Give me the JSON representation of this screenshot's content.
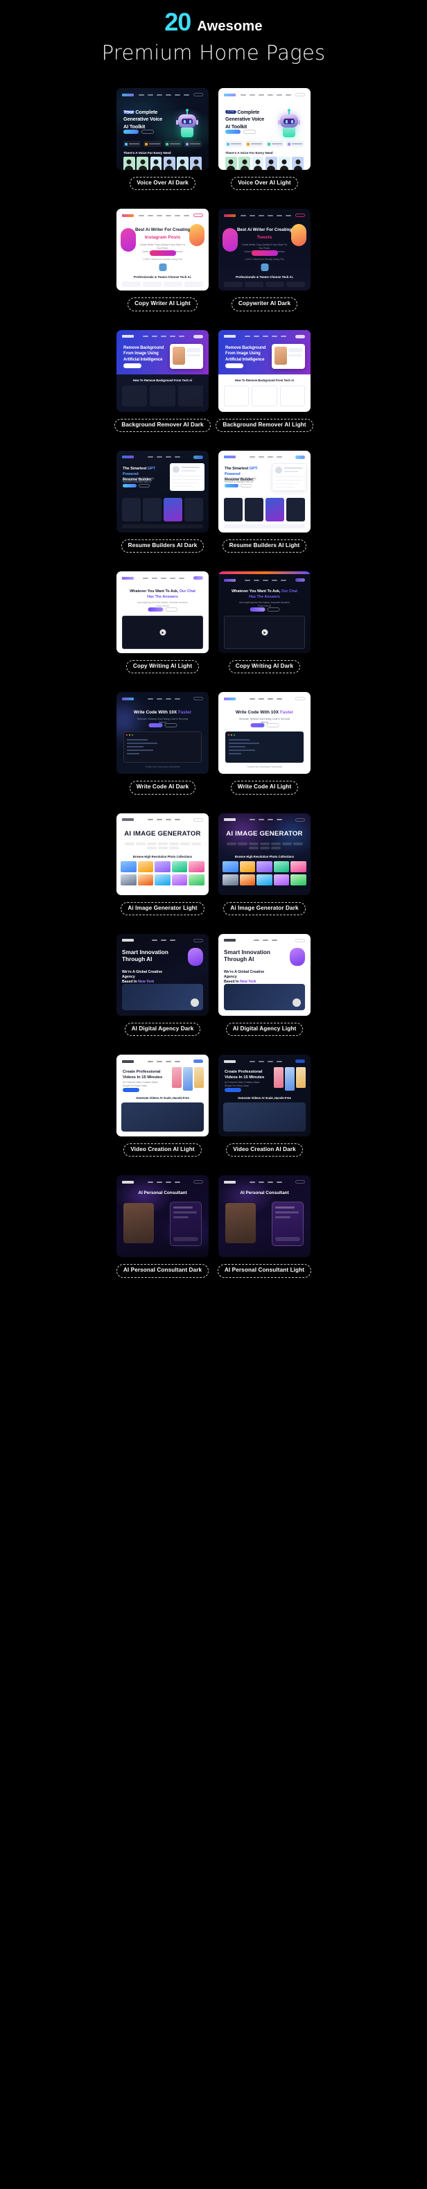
{
  "header": {
    "count": "20",
    "count_color": "#3FDCF7",
    "count_suffix": "Awesome",
    "subtitle": "Premium Home Pages"
  },
  "background_color": "#000000",
  "cards": [
    {
      "id": "voice-over-ai-dark",
      "caption": "Voice Over AI Dark",
      "theme": "dark",
      "preview": {
        "badge": "AI Voice",
        "badge_sub": "Generative Ai Text To Speech",
        "headline": "Your Complete\nGenerative Voice\nAI Toolkit",
        "cta_primary": "Get Started",
        "cta_secondary": "Request A Demo",
        "features": [
          "Text To Speech",
          "Speech To Speech",
          "Voice Editing",
          "Language Dubbing"
        ],
        "section_title": "There's A Voice For Every Need"
      }
    },
    {
      "id": "voice-over-ai-light",
      "caption": "Voice Over AI Light",
      "theme": "light",
      "preview": {
        "badge": "AI Voice",
        "badge_sub": "Generative Ai Text To Speech",
        "headline": "Your Complete\nGenerative Voice\nAI Toolkit",
        "cta_primary": "Get Started",
        "cta_secondary": "Request A Demo",
        "features": [
          "Text To Speech",
          "Speech To Speech",
          "Voice Editing",
          "Language Dubbing"
        ],
        "section_title": "There's A Voice For Every Need"
      }
    },
    {
      "id": "copy-writer-ai-light",
      "caption": "Copy Writer AI Light",
      "theme": "light",
      "preview": {
        "headline": "Best Ai Writer For Creating",
        "headline_accent": "Instagram Posts",
        "accent_color": "#E8317B",
        "cta_primary": "Start Writing Now",
        "cta_note": "1,500+ Clients Are Already Using This",
        "section_title": "Professionals & Teams Choose Tech Ai."
      }
    },
    {
      "id": "copywriter-ai-dark",
      "caption": "Copywriter AI Dark",
      "theme": "dark",
      "preview": {
        "headline": "Best Ai Writer For Creating",
        "headline_accent": "Tweets",
        "accent_color": "#E8317B",
        "cta_primary": "Start Writing Now",
        "cta_note": "1,500+ Clients Are Already Using This",
        "section_title": "Professionals & Teams Choose Tech Ai."
      }
    },
    {
      "id": "background-remover-ai-dark",
      "caption": "Background Remover AI Dark",
      "theme": "dark",
      "preview": {
        "headline": "Remove Background\nFrom Image Using\nArtificial Intelligence",
        "cta_primary": "Upload Image",
        "section_title": "How To Remove Background From Tech Ai"
      }
    },
    {
      "id": "background-remover-ai-light",
      "caption": "Background Remover AI Light",
      "theme": "light",
      "preview": {
        "headline": "Remove Background\nFrom Image Using\nArtificial Intelligence",
        "cta_primary": "Upload Image",
        "section_title": "How To Remove Background From Tech Ai"
      }
    },
    {
      "id": "resume-builders-ai-dark",
      "caption": "Resume Builders AI Dark",
      "theme": "dark",
      "preview": {
        "headline": "The Smartest GPT Powered\nResume Builder.",
        "cta_primary": "Build My Resume",
        "cta_secondary": "See Templates"
      }
    },
    {
      "id": "resume-builders-ai-light",
      "caption": "Resume Builders AI Light",
      "theme": "light",
      "preview": {
        "headline": "The Smartest GPT-Powered\nResume Builder.",
        "cta_primary": "Build My Resume",
        "cta_secondary": "See Templates"
      }
    },
    {
      "id": "copy-writing-ai-light",
      "caption": "Copy Writing AI Light",
      "theme": "light",
      "preview": {
        "headline": "Whatever You Want To Ask,",
        "headline_accent": "Our Chat",
        "headline_line2": "Has The Answers",
        "accent_color": "#6C4BF6"
      }
    },
    {
      "id": "copy-writing-ai-dark",
      "caption": "Copy Writing AI Dark",
      "theme": "dark",
      "preview": {
        "headline": "Whatever You Want To Ask,",
        "headline_accent": "Our Chat",
        "headline_line2": "Has The Answers",
        "accent_color": "#7B5CFF"
      }
    },
    {
      "id": "write-code-ai-dark",
      "caption": "Write Code AI Dark",
      "theme": "dark",
      "preview": {
        "headline": "Write Code With 10X",
        "headline_accent": "Faster",
        "accent_color": "#8B5CF6",
        "cta_primary": "Try It Free",
        "cta_secondary": "View Pricing"
      }
    },
    {
      "id": "write-code-ai-light",
      "caption": "Write Code AI Light",
      "theme": "light",
      "preview": {
        "headline": "Write Code With 10X",
        "headline_accent": "Faster",
        "accent_color": "#8B5CF6",
        "cta_primary": "Try It Free",
        "cta_secondary": "View Pricing"
      }
    },
    {
      "id": "ai-image-generator-light",
      "caption": "Ai Image Generator Light",
      "theme": "light",
      "preview": {
        "headline": "AI IMAGE GENERATOR",
        "section_title": "Browse High Resolution Photo Collections"
      }
    },
    {
      "id": "ai-image-generator-dark",
      "caption": "Ai Image Generator Dark",
      "theme": "dark",
      "preview": {
        "headline": "AI IMAGE GENERATOR",
        "section_title": "Browse High Resolution Photo Collections"
      }
    },
    {
      "id": "ai-digital-agency-dark",
      "caption": "AI Digital Agency Dark",
      "theme": "dark",
      "preview": {
        "headline": "Smart Innovation\nThrough AI",
        "section_title": "We're A Global Creative Agency",
        "section_sub": "Based In New York"
      }
    },
    {
      "id": "ai-digital-agency-light",
      "caption": "AI Digital Agency Light",
      "theme": "light",
      "preview": {
        "headline": "Smart Innovation\nThrough AI",
        "section_title": "We're A Global Creative Agency",
        "section_sub": "Based In New York"
      }
    },
    {
      "id": "video-creation-ai-light",
      "caption": "Video Creation AI Light",
      "theme": "light",
      "preview": {
        "headline": "Create Professional\nVideos In 15 Minutes",
        "section_title": "Generate Videos At Scale, Hassle-Free"
      }
    },
    {
      "id": "video-creation-ai-dark",
      "caption": "Video Creation AI Dark",
      "theme": "dark",
      "preview": {
        "headline": "Create Professional\nVideos In 15 Minutes",
        "section_title": "Generate Videos At Scale, Hassle-Free"
      }
    },
    {
      "id": "ai-personal-consultant-dark",
      "caption": "AI Personal Consultant Dark",
      "theme": "dark",
      "preview": {
        "headline": "AI Personal Consultant"
      }
    },
    {
      "id": "ai-personal-consultant-light",
      "caption": "AI Personal Consultant Light",
      "theme": "light",
      "preview": {
        "headline": "AI Personal Consultant"
      }
    }
  ]
}
